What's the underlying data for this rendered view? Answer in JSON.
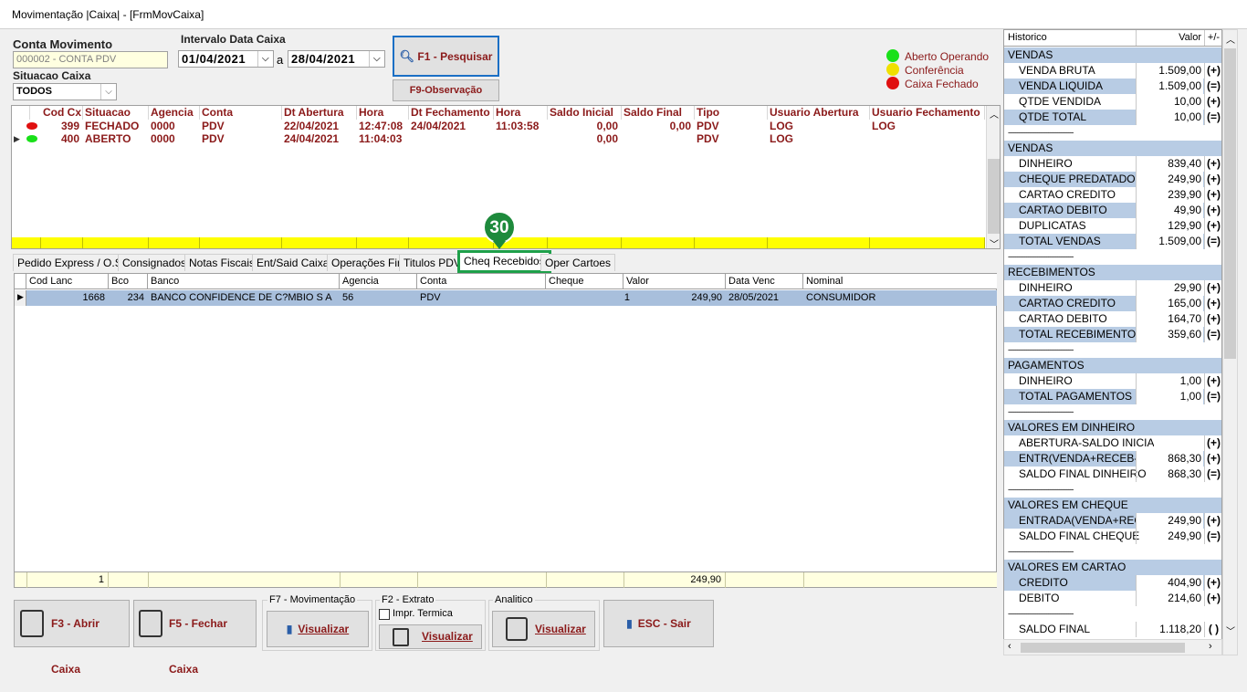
{
  "window": {
    "title": "Movimentação |Caixa| - [FrmMovCaixa]"
  },
  "filter": {
    "conta_label": "Conta Movimento",
    "conta_value": "000002 - CONTA PDV",
    "situacao_label": "Situacao Caixa",
    "situacao_value": "TODOS",
    "intervalo_label": "Intervalo Data Caixa",
    "data_inicio": "01/04/2021",
    "a_label": "a",
    "data_fim": "28/04/2021",
    "pesquisar_label": "F1 - Pesquisar",
    "observacao_label": "F9-Observação"
  },
  "legend": [
    {
      "label": "Aberto Operando",
      "color": "#19e019"
    },
    {
      "label": "Conferência",
      "color": "#f0e000"
    },
    {
      "label": "Caixa Fechado",
      "color": "#e01010"
    }
  ],
  "caixa_grid": {
    "headers": [
      "Cod Cx",
      "Situacao",
      "Agencia",
      "Conta",
      "Dt Abertura",
      "Hora",
      "Dt Fechamento",
      "Hora",
      "Saldo Inicial",
      "Saldo Final",
      "Tipo",
      "Usuario Abertura",
      "Usuario Fechamento"
    ],
    "rows": [
      {
        "status_color": "#e01010",
        "cod": "399",
        "situacao": "FECHADO",
        "agencia": "0000",
        "conta": "PDV",
        "dt_abertura": "22/04/2021",
        "hora_ab": "12:47:08",
        "dt_fechamento": "24/04/2021",
        "hora_fe": "11:03:58",
        "saldo_inicial": "0,00",
        "saldo_final": "0,00",
        "tipo": "PDV",
        "usuario_ab": "LOG",
        "usuario_fe": "LOG"
      },
      {
        "status_color": "#19e019",
        "cod": "400",
        "situacao": "ABERTO",
        "agencia": "0000",
        "conta": "PDV",
        "dt_abertura": "24/04/2021",
        "hora_ab": "11:04:03",
        "dt_fechamento": "",
        "hora_fe": "",
        "saldo_inicial": "0,00",
        "saldo_final": "",
        "tipo": "PDV",
        "usuario_ab": "LOG",
        "usuario_fe": ""
      }
    ]
  },
  "tabs": [
    "Pedido Express / O.S",
    "Consignados",
    "Notas Fiscais",
    "Ent/Said Caixa",
    "Operações Fin",
    "Titulos PDV",
    "Cheq Recebidos",
    "Oper Cartoes"
  ],
  "active_tab": "Cheq Recebidos",
  "badge": "30",
  "cheque_grid": {
    "headers": [
      "Cod Lanc",
      "Bco",
      "Banco",
      "Agencia",
      "Conta",
      "Cheque",
      "Valor",
      "Data Venc",
      "Nominal"
    ],
    "rows": [
      {
        "cod": "1668",
        "bco": "234",
        "banco": "BANCO CONFIDENCE DE C?MBIO S A",
        "agencia": "56",
        "conta": "PDV",
        "cheque": "1",
        "valor": "249,90",
        "data_venc": "28/05/2021",
        "nominal": "CONSUMIDOR"
      }
    ],
    "footer": {
      "count": "1",
      "valor": "249,90"
    }
  },
  "bottom": {
    "abrir": "F3 - Abrir Caixa",
    "fechar": "F5 - Fechar Caixa",
    "movimentacao_group": "F7 - Movimentação",
    "movimentacao_btn": "Visualizar",
    "extrato_group": "F2 - Extrato",
    "impr_termica": "Impr. Termica",
    "extrato_btn": "Visualizar",
    "analitico_group": "Analitico",
    "analitico_btn": "Visualizar",
    "sair": "ESC - Sair"
  },
  "historico": {
    "headers": [
      "Historico",
      "Valor",
      "+/-"
    ],
    "rows": [
      {
        "type": "hdr",
        "n": "VENDAS",
        "v": "",
        "s": ""
      },
      {
        "type": "item",
        "n": "VENDA BRUTA",
        "v": "1.509,00",
        "s": "(+)"
      },
      {
        "type": "item",
        "n": "VENDA LIQUIDA",
        "v": "1.509,00",
        "s": "(=)"
      },
      {
        "type": "item",
        "n": "QTDE VENDIDA",
        "v": "10,00",
        "s": "(+)"
      },
      {
        "type": "item",
        "n": "QTDE TOTAL",
        "v": "10,00",
        "s": "(=)"
      },
      {
        "type": "sep",
        "n": "------------------------------------",
        "v": "",
        "s": ""
      },
      {
        "type": "hdr",
        "n": "VENDAS",
        "v": "",
        "s": ""
      },
      {
        "type": "item",
        "n": "DINHEIRO",
        "v": "839,40",
        "s": "(+)"
      },
      {
        "type": "item",
        "n": "CHEQUE PREDATADO",
        "v": "249,90",
        "s": "(+)"
      },
      {
        "type": "item",
        "n": "CARTAO CREDITO",
        "v": "239,90",
        "s": "(+)"
      },
      {
        "type": "item",
        "n": "CARTAO DEBITO",
        "v": "49,90",
        "s": "(+)"
      },
      {
        "type": "item",
        "n": "DUPLICATAS",
        "v": "129,90",
        "s": "(+)"
      },
      {
        "type": "item",
        "n": "TOTAL VENDAS",
        "v": "1.509,00",
        "s": "(=)"
      },
      {
        "type": "sep",
        "n": "------------------------------------",
        "v": "",
        "s": ""
      },
      {
        "type": "hdr",
        "n": "RECEBIMENTOS",
        "v": "",
        "s": ""
      },
      {
        "type": "item",
        "n": "DINHEIRO",
        "v": "29,90",
        "s": "(+)"
      },
      {
        "type": "item",
        "n": "CARTAO CREDITO",
        "v": "165,00",
        "s": "(+)"
      },
      {
        "type": "item",
        "n": "CARTAO DEBITO",
        "v": "164,70",
        "s": "(+)"
      },
      {
        "type": "item",
        "n": "TOTAL RECEBIMENTOS",
        "v": "359,60",
        "s": "(=)"
      },
      {
        "type": "sep",
        "n": "------------------------------------",
        "v": "",
        "s": ""
      },
      {
        "type": "hdr",
        "n": "PAGAMENTOS",
        "v": "",
        "s": ""
      },
      {
        "type": "item",
        "n": "DINHEIRO",
        "v": "1,00",
        "s": "(+)"
      },
      {
        "type": "item",
        "n": "TOTAL PAGAMENTOS",
        "v": "1,00",
        "s": "(=)"
      },
      {
        "type": "sep",
        "n": "------------------------------------",
        "v": "",
        "s": ""
      },
      {
        "type": "hdr",
        "n": "VALORES EM DINHEIRO",
        "v": "",
        "s": ""
      },
      {
        "type": "item",
        "n": "ABERTURA-SALDO INICIA",
        "v": "",
        "s": "(+)"
      },
      {
        "type": "item",
        "n": "ENTR(VENDA+RECEB-PG",
        "v": "868,30",
        "s": "(+)"
      },
      {
        "type": "item",
        "n": "SALDO FINAL DINHEIRO",
        "v": "868,30",
        "s": "(=)"
      },
      {
        "type": "sep",
        "n": "------------------------------------",
        "v": "",
        "s": ""
      },
      {
        "type": "hdr",
        "n": "VALORES EM CHEQUE",
        "v": "",
        "s": ""
      },
      {
        "type": "item",
        "n": "ENTRADA(VENDA+RECEE",
        "v": "249,90",
        "s": "(+)"
      },
      {
        "type": "item",
        "n": "SALDO FINAL CHEQUE",
        "v": "249,90",
        "s": "(=)"
      },
      {
        "type": "sep",
        "n": "------------------------------------",
        "v": "",
        "s": ""
      },
      {
        "type": "hdr",
        "n": "VALORES EM CARTAO",
        "v": "",
        "s": ""
      },
      {
        "type": "item",
        "n": "CREDITO",
        "v": "404,90",
        "s": "(+)"
      },
      {
        "type": "item",
        "n": "DEBITO",
        "v": "214,60",
        "s": "(+)"
      },
      {
        "type": "sep",
        "n": "------------------------------------",
        "v": "",
        "s": ""
      },
      {
        "type": "item",
        "n": "SALDO FINAL",
        "v": "1.118,20",
        "s": "( )"
      }
    ]
  }
}
